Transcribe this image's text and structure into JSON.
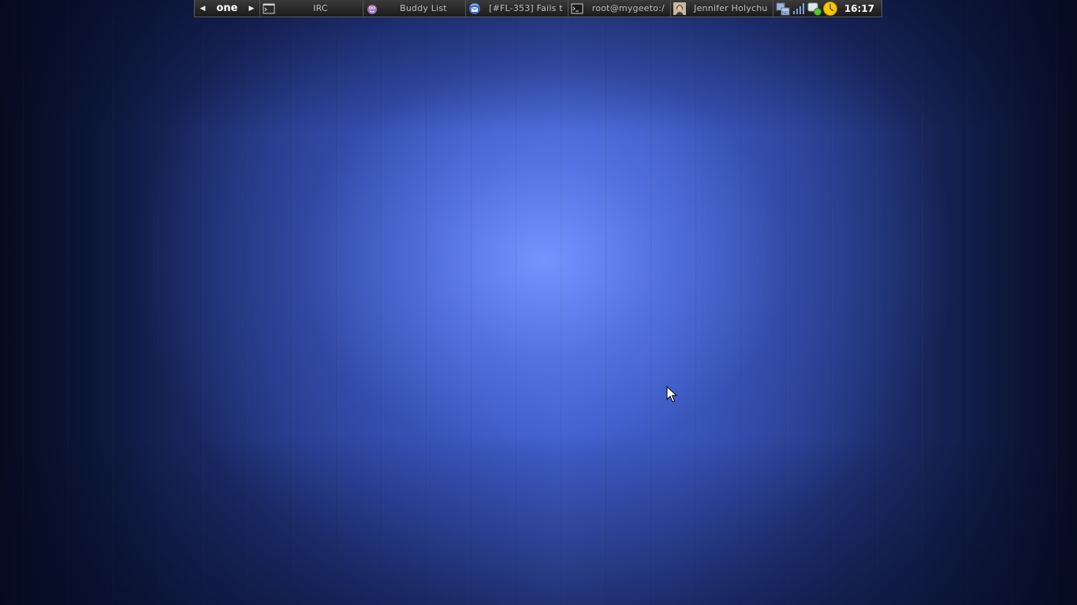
{
  "panel": {
    "prev_arrow": "◀",
    "next_arrow": "▶",
    "desktop_name": "one",
    "tasks": [
      {
        "label": "IRC",
        "icon": "terminal-icon"
      },
      {
        "label": "Buddy List",
        "icon": "pidgin-icon"
      },
      {
        "label": "[#FL-353] Fails t",
        "icon": "thunderbird-icon"
      },
      {
        "label": "root@mygeeto:/",
        "icon": "terminal-icon"
      },
      {
        "label": "Jennifer Holychu",
        "icon": "avatar-icon"
      }
    ],
    "tray": {
      "icons": [
        "network-manager-icon",
        "signal-strength-icon",
        "chat-status-icon",
        "clock-applet-icon"
      ],
      "clock": "16:17"
    }
  },
  "colors": {
    "panel_background": "#222222",
    "desktop_center": "#6f8fff",
    "desktop_edge": "#070c22"
  }
}
